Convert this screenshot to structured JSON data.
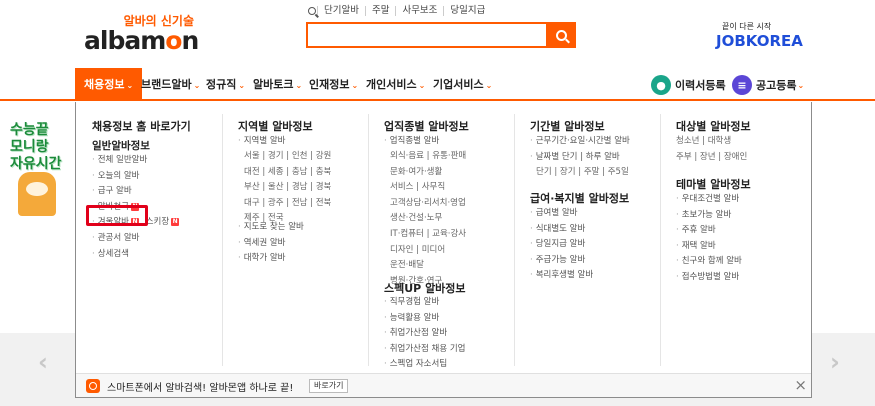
{
  "header": {
    "logo_tagline": "알바의 신기술",
    "logo_text_pre": "albam",
    "logo_text_accent": "o",
    "logo_text_post": "n",
    "quick_links": [
      "단기알바",
      "주말",
      "사무보조",
      "당일지급"
    ],
    "search_value": "",
    "partner_tagline": "끝이 다른 시작",
    "partner_logo": "JOBKOREA"
  },
  "nav": {
    "items": [
      "채용정보",
      "브랜드알바",
      "정규직",
      "알바토크",
      "인재정보",
      "개인서비스",
      "기업서비스"
    ],
    "resume_label": "이력서등록",
    "post_label": "공고등록"
  },
  "promo": {
    "lines": [
      "수능끝",
      "모니랑",
      "자유시간"
    ]
  },
  "panel": {
    "col1": {
      "title": "채용정보 홈 바로가기",
      "subtitle": "일반알바정보",
      "items": [
        "전체 일반알바",
        "오늘의 알바",
        "급구 알바",
        "알바천국",
        "겨울알바",
        "관공서 알바",
        "상세검색"
      ],
      "fragment_pre": "알",
      "fragment_post": "정",
      "side_label": "스키장",
      "new_badge": "N"
    },
    "col2": {
      "title": "지역별 알바정보",
      "items": [
        "지역별 알바"
      ],
      "regions": [
        "서울 | 경기 | 인천 | 강원",
        "대전 | 세종 | 충남 | 충북",
        "부산 | 울산 | 경남 | 경북",
        "대구 | 광주 | 전남 | 전북",
        "제주 | 전국"
      ],
      "items2": [
        "지도로 찾는 알바",
        "역세권 알바",
        "대학가 알바"
      ]
    },
    "col3": {
      "title": "업직종별 알바정보",
      "items": [
        "업직종별 알바"
      ],
      "categories": [
        "외식·음료 | 유통·판매",
        "문화·여가·생활",
        "서비스 | 사무직",
        "고객상담·리서치·영업",
        "생산·건설·노무",
        "IT·컴퓨터 | 교육·강사",
        "디자인 | 미디어",
        "운전·배달",
        "병원·간호·연구"
      ],
      "subtitle": "스펙UP 알바정보",
      "items2": [
        "직무경험 알바",
        "능력활용 알바",
        "취업가산점 알바",
        "취업가산점 채용 기업",
        "스펙업 자소서팁"
      ]
    },
    "col4": {
      "title": "기간별 알바정보",
      "items": [
        "근무기간·요일·시간별 알바",
        "날짜별 단기 | 하루 알바"
      ],
      "plain": [
        "단기 | 장기 | 주말 | 주5일"
      ],
      "subtitle": "급여·복지별 알바정보",
      "items2": [
        "급여별 알바",
        "식대별도 알바",
        "당일지급 알바",
        "주급가능 알바",
        "복리후생별 알바"
      ]
    },
    "col5": {
      "title": "대상별 알바정보",
      "plain": [
        "청소년 | 대학생",
        "주부 | 장년 | 장애인"
      ],
      "subtitle": "테마별 알바정보",
      "items": [
        "우대조건별 알바",
        "초보가능 알바",
        "주휴 알바",
        "재택 알바",
        "친구와 함께 알바",
        "접수방법별 알바"
      ]
    },
    "bottom": {
      "message": "스마트폰에서 알바검색! 알바몬앱 하나로 끝!",
      "button_label": "바로가기",
      "close_symbol": "×"
    }
  },
  "carousel": {
    "prev": "‹",
    "next": "›"
  },
  "colors": {
    "brand": "#ff5a00",
    "jobkorea": "#1f4ed8",
    "highlight": "#e1001a"
  }
}
